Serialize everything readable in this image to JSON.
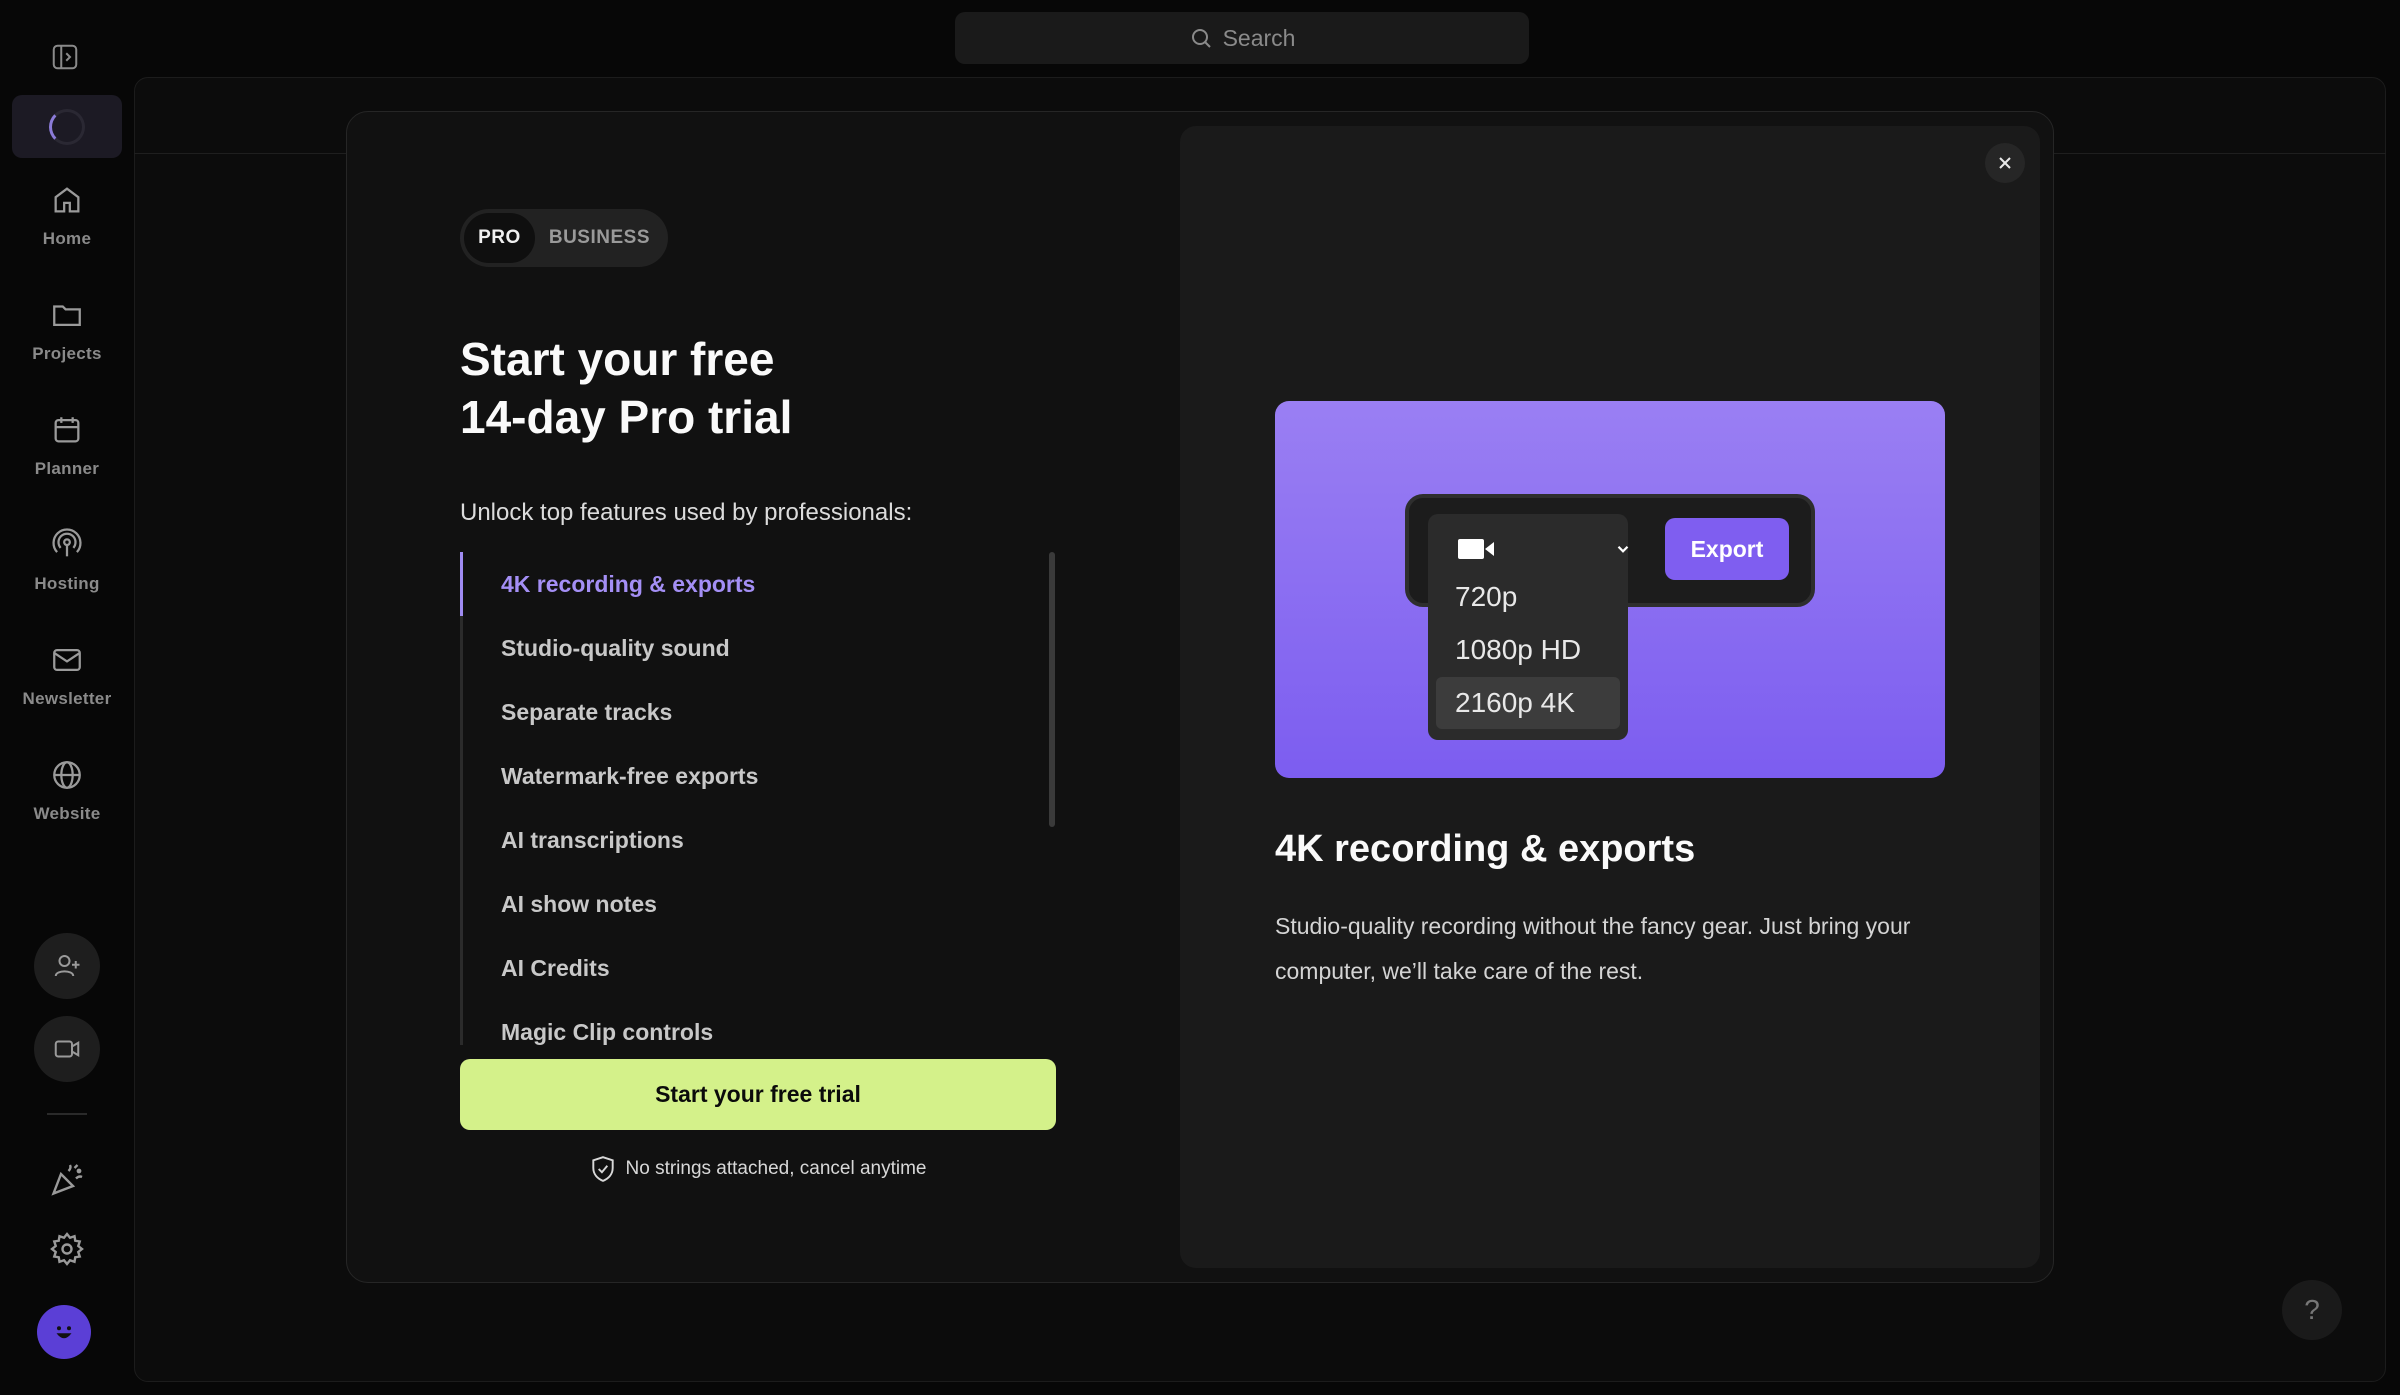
{
  "search": {
    "placeholder": "Search"
  },
  "sidebar": {
    "items": [
      {
        "label": "Home",
        "icon": "home-icon"
      },
      {
        "label": "Projects",
        "icon": "folder-icon"
      },
      {
        "label": "Planner",
        "icon": "calendar-icon"
      },
      {
        "label": "Hosting",
        "icon": "podcast-icon"
      },
      {
        "label": "Newsletter",
        "icon": "mail-icon"
      },
      {
        "label": "Website",
        "icon": "globe-icon"
      }
    ]
  },
  "modal": {
    "plan_tabs": [
      "PRO",
      "BUSINESS"
    ],
    "active_plan": "PRO",
    "title_line1": "Start your free",
    "title_line2": "14-day Pro trial",
    "subtitle": "Unlock top features used by professionals:",
    "features": [
      "4K recording & exports",
      "Studio-quality sound",
      "Separate tracks",
      "Watermark-free exports",
      "AI transcriptions",
      "AI show notes",
      "AI Credits",
      "Magic Clip controls"
    ],
    "active_feature_index": 0,
    "cta_label": "Start your free trial",
    "note": "No strings attached, cancel anytime",
    "detail": {
      "title": "4K recording & exports",
      "description": "Studio-quality recording without the fancy gear. Just bring your computer, we’ll take care of the rest."
    },
    "illustration": {
      "options": [
        "720p",
        "1080p HD",
        "2160p 4K"
      ],
      "selected_option": "2160p 4K",
      "export_label": "Export"
    }
  },
  "colors": {
    "accent_purple": "#a48ff5",
    "cta_green": "#d4f18a",
    "export_purple": "#7f5ef0"
  },
  "help": {
    "label": "?"
  }
}
